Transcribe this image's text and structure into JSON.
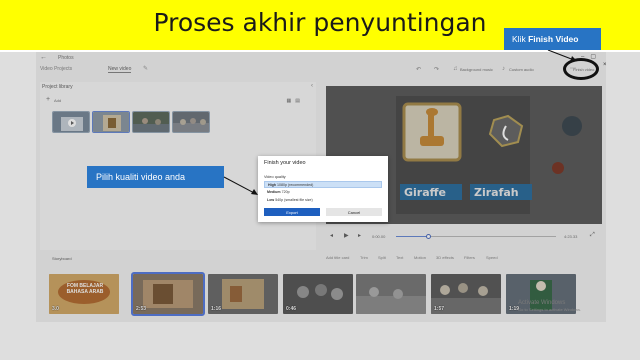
{
  "banner": {
    "title": "Proses akhir penyuntingan"
  },
  "window": {
    "app_title": "Photos",
    "breadcrumb": [
      "Video Projects",
      "New video"
    ],
    "toolbar": {
      "undo": "Undo",
      "redo": "Redo",
      "background_music": "Background music",
      "custom_audio": "Custom audio",
      "finish_video": "Finish video",
      "close": "×"
    }
  },
  "library": {
    "title": "Project library",
    "add_label": "Add",
    "thumbnails": [
      "clip-1",
      "clip-2",
      "clip-3",
      "clip-4"
    ]
  },
  "preview": {
    "time_current": "0:00.00",
    "time_total": "4:23.33",
    "progress": 0.2,
    "text_left": "Giraffe",
    "text_right": "Zirafah",
    "text_top": "J"
  },
  "storyboard": {
    "title": "Storyboard",
    "actions": [
      "Add title card",
      "Trim",
      "Split",
      "Text",
      "Motion",
      "3D effects",
      "Filters",
      "Speed"
    ],
    "clips": [
      {
        "label": "FOM BELAJAR BAHASA ARAB",
        "duration": "3.0"
      },
      {
        "label": "",
        "duration": "2:53"
      },
      {
        "label": "",
        "duration": "1:16"
      },
      {
        "label": "",
        "duration": "0:46"
      },
      {
        "label": "",
        "duration": ""
      },
      {
        "label": "",
        "duration": "1:57"
      },
      {
        "label": "",
        "duration": "1:19"
      }
    ]
  },
  "watermark": {
    "line1": "Activate Windows",
    "line2": "Go to Settings to activate Windows."
  },
  "dialog": {
    "title": "Finish your video",
    "quality_label": "Video quality",
    "options": [
      {
        "name": "High",
        "detail": "1080p (recommended)"
      },
      {
        "name": "Medium",
        "detail": "720p"
      },
      {
        "name": "Low",
        "detail": "540p (smallest file size)"
      }
    ],
    "export_label": "Export",
    "cancel_label": "Cancel"
  },
  "callouts": {
    "left": "Pilih kualiti video anda",
    "right_prefix": "Klik ",
    "right_bold": "Finish Video"
  },
  "colors": {
    "banner": "#ffff00",
    "callout": "#2874c4",
    "accent": "#1e5fbf"
  }
}
